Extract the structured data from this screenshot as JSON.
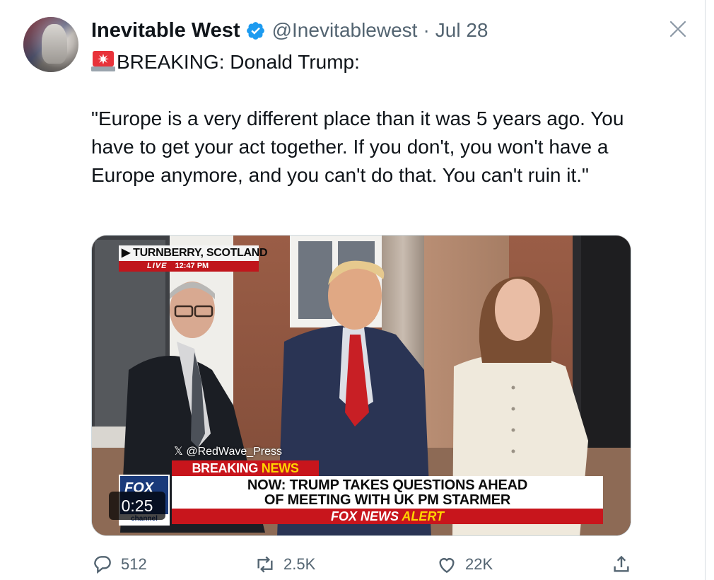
{
  "tweet": {
    "author_name": "Inevitable West",
    "handle": "@Inevitablewest",
    "separator": "·",
    "date": "Jul 28",
    "text_line1": "BREAKING: Donald Trump:",
    "quote": "\"Europe is a very different place than it was 5 years ago. You have to get your act together. If you don't, you won't have a Europe anymore, and you can't do that. You can't ruin it.\""
  },
  "video": {
    "location": "▶ TURNBERRY, SCOTLAND",
    "live_label": "LIVE",
    "live_time": "12:47 PM",
    "watermark": "𝕏 @RedWave_Press",
    "breaking_word": "BREAKING",
    "news_word": "NEWS",
    "headline_line1": "NOW: TRUMP TAKES QUESTIONS AHEAD",
    "headline_line2": "OF MEETING WITH UK PM STARMER",
    "alert_prefix": "FOX NEWS",
    "alert_word": "ALERT",
    "channel_logo_text": "FOX",
    "channel_label": "channel",
    "duration": "0:25"
  },
  "actions": [
    {
      "icon": "reply-icon",
      "count": "512"
    },
    {
      "icon": "repost-icon",
      "count": "2.5K"
    },
    {
      "icon": "like-icon",
      "count": "22K"
    },
    {
      "icon": "share-icon",
      "count": ""
    }
  ],
  "colors": {
    "verified": "#1d9bf0",
    "text": "#0f1419",
    "muted": "#536471",
    "fox_red": "#c8151c",
    "fox_yellow": "#ffd400"
  }
}
